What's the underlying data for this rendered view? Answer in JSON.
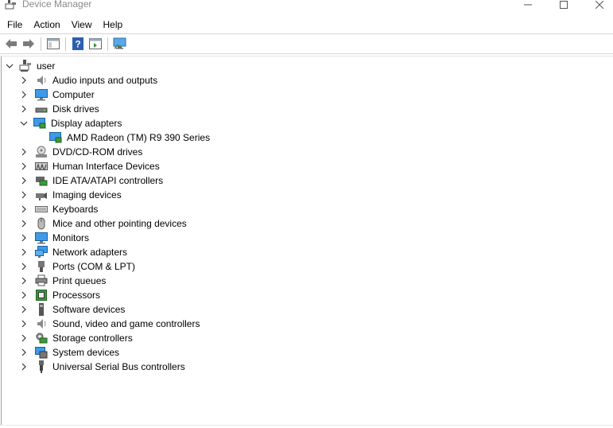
{
  "window": {
    "title": "Device Manager",
    "min_glyph": "—",
    "max_glyph": "☐",
    "close_glyph": "✕"
  },
  "menu": [
    "File",
    "Action",
    "View",
    "Help"
  ],
  "toolbar": [
    "back-icon",
    "forward-icon",
    "show-hide-console-tree-icon",
    "help-icon",
    "properties-pane-icon",
    "monitor-scan-icon"
  ],
  "tree": {
    "root": {
      "label": "user",
      "icon": "computer-user-icon",
      "expanded": true
    },
    "items": [
      {
        "label": "Audio inputs and outputs",
        "icon": "speaker-icon",
        "expanded": false
      },
      {
        "label": "Computer",
        "icon": "computer-icon",
        "expanded": false
      },
      {
        "label": "Disk drives",
        "icon": "disk-drive-icon",
        "expanded": false
      },
      {
        "label": "Display adapters",
        "icon": "display-adapter-icon",
        "expanded": true,
        "children": [
          {
            "label": "AMD Radeon (TM) R9 390 Series",
            "icon": "display-adapter-icon"
          }
        ]
      },
      {
        "label": "DVD/CD-ROM drives",
        "icon": "dvd-drive-icon",
        "expanded": false
      },
      {
        "label": "Human Interface Devices",
        "icon": "hid-icon",
        "expanded": false
      },
      {
        "label": "IDE ATA/ATAPI controllers",
        "icon": "ide-controller-icon",
        "expanded": false
      },
      {
        "label": "Imaging devices",
        "icon": "camera-icon",
        "expanded": false
      },
      {
        "label": "Keyboards",
        "icon": "keyboard-icon",
        "expanded": false
      },
      {
        "label": "Mice and other pointing devices",
        "icon": "mouse-icon",
        "expanded": false
      },
      {
        "label": "Monitors",
        "icon": "monitor-icon",
        "expanded": false
      },
      {
        "label": "Network adapters",
        "icon": "network-adapter-icon",
        "expanded": false
      },
      {
        "label": "Ports (COM & LPT)",
        "icon": "port-icon",
        "expanded": false
      },
      {
        "label": "Print queues",
        "icon": "printer-icon",
        "expanded": false
      },
      {
        "label": "Processors",
        "icon": "processor-icon",
        "expanded": false
      },
      {
        "label": "Software devices",
        "icon": "software-device-icon",
        "expanded": false
      },
      {
        "label": "Sound, video and game controllers",
        "icon": "speaker-icon",
        "expanded": false
      },
      {
        "label": "Storage controllers",
        "icon": "storage-controller-icon",
        "expanded": false
      },
      {
        "label": "System devices",
        "icon": "system-device-icon",
        "expanded": false
      },
      {
        "label": "Universal Serial Bus controllers",
        "icon": "usb-icon",
        "expanded": false
      }
    ]
  },
  "colors": {
    "title_text": "#8a8a8a",
    "icon_blue": "#2a7fd4",
    "icon_green": "#4caf50",
    "icon_gray": "#6e6e6e"
  }
}
